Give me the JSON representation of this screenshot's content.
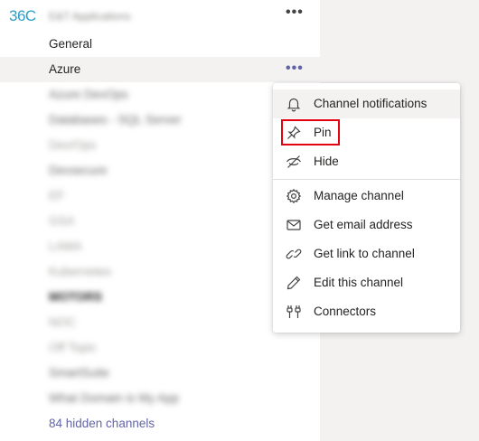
{
  "team": {
    "logo_text": "36C",
    "name": "E&T Applications",
    "more_glyph": "•••"
  },
  "channels": [
    {
      "label": "General",
      "style": "normal"
    },
    {
      "label": "Azure",
      "style": "active"
    },
    {
      "label": "Azure DevOps",
      "style": "blur"
    },
    {
      "label": "Databases - SQL Server",
      "style": "blur"
    },
    {
      "label": "Dev/Ops",
      "style": "blur"
    },
    {
      "label": "Devsecure",
      "style": "blur"
    },
    {
      "label": "EF",
      "style": "blur-faint"
    },
    {
      "label": "GSA",
      "style": "blur-faint"
    },
    {
      "label": "LAMA",
      "style": "blur-faint"
    },
    {
      "label": "Kubernetes",
      "style": "blur-faint"
    },
    {
      "label": "MOTORS",
      "style": "blur-bold"
    },
    {
      "label": "NOC",
      "style": "blur-faint"
    },
    {
      "label": "Off Topic",
      "style": "blur-faint"
    },
    {
      "label": "SmartSuite",
      "style": "blur"
    },
    {
      "label": "What Domain is My App",
      "style": "blur"
    }
  ],
  "hidden_channels_label": "84 hidden channels",
  "azure_more_glyph": "•••",
  "menu": {
    "items": [
      {
        "label": "Channel notifications",
        "icon": "bell-icon"
      },
      {
        "label": "Pin",
        "icon": "pin-icon"
      },
      {
        "label": "Hide",
        "icon": "eye-off-icon"
      },
      {
        "label": "Manage channel",
        "icon": "gear-icon"
      },
      {
        "label": "Get email address",
        "icon": "envelope-icon"
      },
      {
        "label": "Get link to channel",
        "icon": "link-icon"
      },
      {
        "label": "Edit this channel",
        "icon": "pencil-icon"
      },
      {
        "label": "Connectors",
        "icon": "plug-icon"
      }
    ]
  },
  "colors": {
    "accent": "#6264a7",
    "highlight": "#e3000f",
    "logo": "#2aa0c6"
  }
}
